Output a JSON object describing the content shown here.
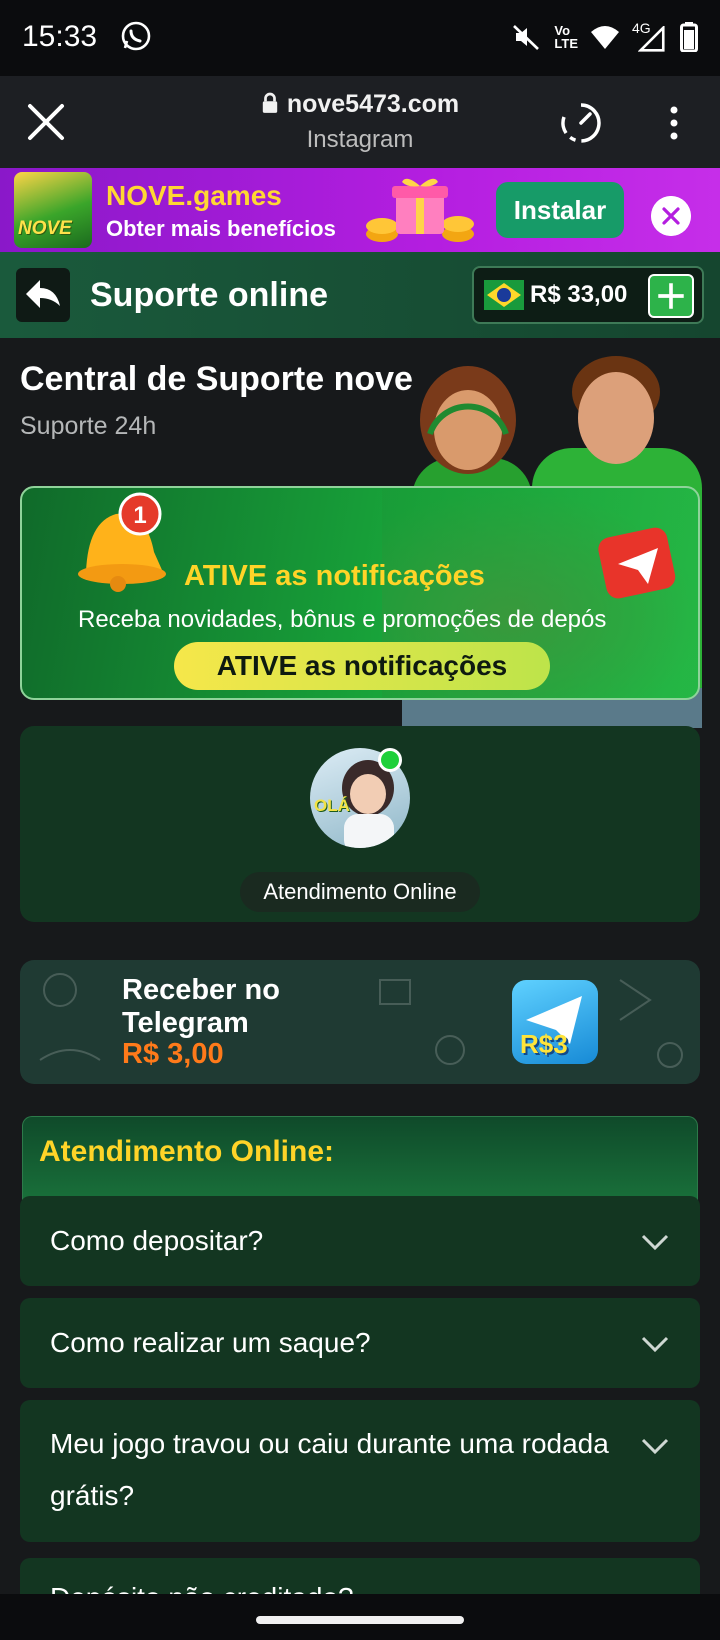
{
  "status_bar": {
    "time": "15:33",
    "network_label": "4G",
    "volte_label_top": "Vo",
    "volte_label_bottom": "LTE"
  },
  "browser": {
    "url": "nove5473.com",
    "subtitle": "Instagram"
  },
  "install_banner": {
    "app_name": "NOVE.games",
    "app_subtitle": "Obter mais benefícios",
    "logo_text": "NOVE",
    "install_label": "Instalar",
    "brand_color": "#b41ee0"
  },
  "header": {
    "title": "Suporte online",
    "balance": "R$ 33,00"
  },
  "central": {
    "title": "Central de Suporte nove",
    "subtitle": "Suporte 24h"
  },
  "notification": {
    "badge_count": "1",
    "title": "ATIVE as notificações",
    "description": "Receba novidades, bônus e promoções de depós",
    "button_label": "ATIVE as notificações"
  },
  "online": {
    "avatar_text": "OLÁ",
    "label": "Atendimento Online",
    "status_color": "#1ed03a"
  },
  "telegram": {
    "title": "Receber no Telegram",
    "amount": "R$ 3,00",
    "icon_text": "R$3",
    "amount_color": "#ff7a1a"
  },
  "faq": {
    "heading": "Atendimento Online:",
    "items": [
      {
        "question": "Como depositar?"
      },
      {
        "question": "Como realizar um saque?"
      },
      {
        "question": "Meu jogo travou ou caiu durante uma rodada grátis?"
      },
      {
        "question": "Depósito não creditado?"
      }
    ]
  },
  "colors": {
    "accent_yellow": "#ffd428",
    "card_green": "#133621"
  }
}
